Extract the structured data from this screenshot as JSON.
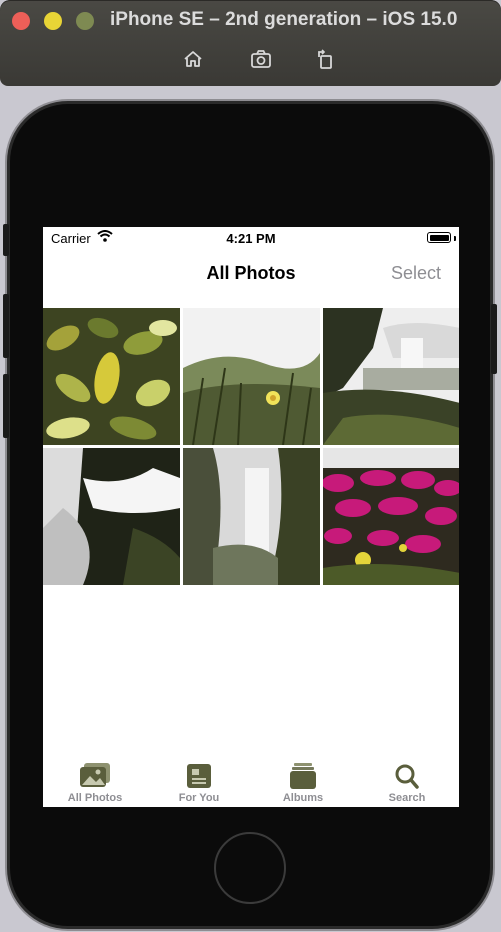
{
  "window": {
    "title": "iPhone SE – 2nd generation – iOS 15.0",
    "toolbar": [
      "home-icon",
      "screenshot-icon",
      "rotate-icon"
    ]
  },
  "status_bar": {
    "carrier": "Carrier",
    "time": "4:21 PM"
  },
  "nav": {
    "title": "All Photos",
    "select_label": "Select"
  },
  "photos": [
    {
      "subject": "leaves"
    },
    {
      "subject": "meadow-flower"
    },
    {
      "subject": "waterfall-coast"
    },
    {
      "subject": "waterfall-closeup"
    },
    {
      "subject": "canyon-waterfall"
    },
    {
      "subject": "pink-flowers"
    }
  ],
  "tabs": [
    {
      "label": "All Photos",
      "icon": "photos-icon",
      "active": true
    },
    {
      "label": "For You",
      "icon": "for-you-icon",
      "active": false
    },
    {
      "label": "Albums",
      "icon": "albums-icon",
      "active": false
    },
    {
      "label": "Search",
      "icon": "search-icon",
      "active": false
    }
  ],
  "colors": {
    "accent_icon": "#5a5e3c",
    "select_gray": "#8e8e93"
  }
}
